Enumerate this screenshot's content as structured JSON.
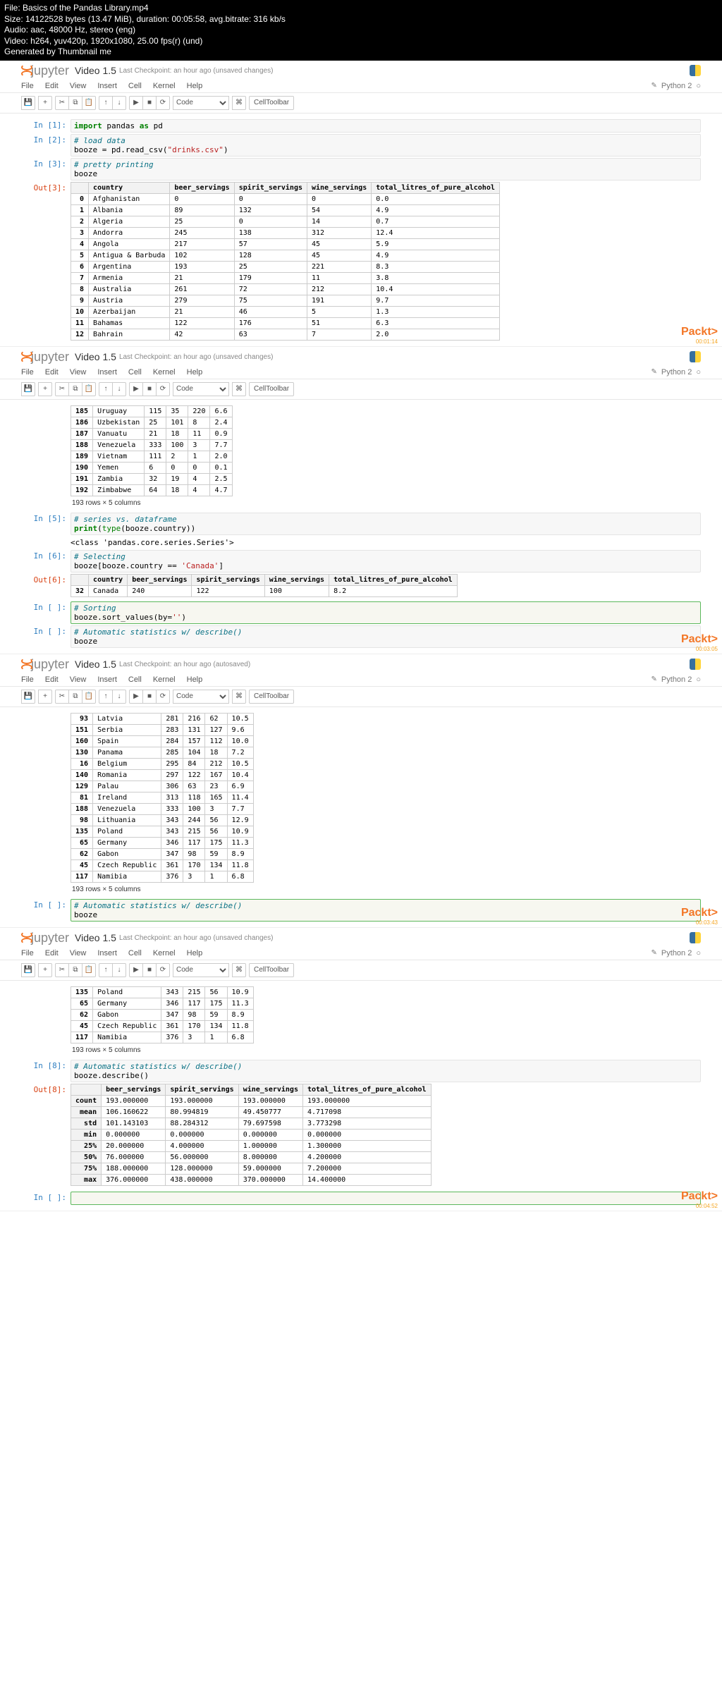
{
  "terminal": {
    "file": "File: Basics of the Pandas Library.mp4",
    "size": "Size: 14122528 bytes (13.47 MiB), duration: 00:05:58, avg.bitrate: 316 kb/s",
    "audio": "Audio: aac, 48000 Hz, stereo (eng)",
    "video": "Video: h264, yuv420p, 1920x1080, 25.00 fps(r) (und)",
    "gen": "Generated by Thumbnail me"
  },
  "brand": "jupyter",
  "title": "Video 1.5",
  "menus": [
    "File",
    "Edit",
    "View",
    "Insert",
    "Cell",
    "Kernel",
    "Help"
  ],
  "kernel": "Python 2",
  "toolbar": {
    "code": "Code",
    "celltb": "CellToolbar"
  },
  "packt": "Packt",
  "rowscols": "193 rows × 5 columns",
  "shots": {
    "s1": {
      "checkpoint": "Last Checkpoint: an hour ago (unsaved changes)",
      "ts": "00:01:14",
      "cols": [
        "country",
        "beer_servings",
        "spirit_servings",
        "wine_servings",
        "total_litres_of_pure_alcohol"
      ],
      "rows": [
        [
          "0",
          "Afghanistan",
          "0",
          "0",
          "0",
          "0.0"
        ],
        [
          "1",
          "Albania",
          "89",
          "132",
          "54",
          "4.9"
        ],
        [
          "2",
          "Algeria",
          "25",
          "0",
          "14",
          "0.7"
        ],
        [
          "3",
          "Andorra",
          "245",
          "138",
          "312",
          "12.4"
        ],
        [
          "4",
          "Angola",
          "217",
          "57",
          "45",
          "5.9"
        ],
        [
          "5",
          "Antigua & Barbuda",
          "102",
          "128",
          "45",
          "4.9"
        ],
        [
          "6",
          "Argentina",
          "193",
          "25",
          "221",
          "8.3"
        ],
        [
          "7",
          "Armenia",
          "21",
          "179",
          "11",
          "3.8"
        ],
        [
          "8",
          "Australia",
          "261",
          "72",
          "212",
          "10.4"
        ],
        [
          "9",
          "Austria",
          "279",
          "75",
          "191",
          "9.7"
        ],
        [
          "10",
          "Azerbaijan",
          "21",
          "46",
          "5",
          "1.3"
        ],
        [
          "11",
          "Bahamas",
          "122",
          "176",
          "51",
          "6.3"
        ],
        [
          "12",
          "Bahrain",
          "42",
          "63",
          "7",
          "2.0"
        ]
      ]
    },
    "s2": {
      "checkpoint": "Last Checkpoint: an hour ago (unsaved changes)",
      "ts": "00:03:05",
      "rows": [
        [
          "185",
          "Uruguay",
          "115",
          "35",
          "220",
          "6.6"
        ],
        [
          "186",
          "Uzbekistan",
          "25",
          "101",
          "8",
          "2.4"
        ],
        [
          "187",
          "Vanuatu",
          "21",
          "18",
          "11",
          "0.9"
        ],
        [
          "188",
          "Venezuela",
          "333",
          "100",
          "3",
          "7.7"
        ],
        [
          "189",
          "Vietnam",
          "111",
          "2",
          "1",
          "2.0"
        ],
        [
          "190",
          "Yemen",
          "6",
          "0",
          "0",
          "0.1"
        ],
        [
          "191",
          "Zambia",
          "32",
          "19",
          "4",
          "2.5"
        ],
        [
          "192",
          "Zimbabwe",
          "64",
          "18",
          "4",
          "4.7"
        ]
      ],
      "classout": "<class 'pandas.core.series.Series'>",
      "selcols": [
        "country",
        "beer_servings",
        "spirit_servings",
        "wine_servings",
        "total_litres_of_pure_alcohol"
      ],
      "selrow": [
        "32",
        "Canada",
        "240",
        "122",
        "100",
        "8.2"
      ]
    },
    "s3": {
      "checkpoint": "Last Checkpoint: an hour ago (autosaved)",
      "ts": "00:03:43",
      "rows": [
        [
          "93",
          "Latvia",
          "281",
          "216",
          "62",
          "10.5"
        ],
        [
          "151",
          "Serbia",
          "283",
          "131",
          "127",
          "9.6"
        ],
        [
          "160",
          "Spain",
          "284",
          "157",
          "112",
          "10.0"
        ],
        [
          "130",
          "Panama",
          "285",
          "104",
          "18",
          "7.2"
        ],
        [
          "16",
          "Belgium",
          "295",
          "84",
          "212",
          "10.5"
        ],
        [
          "140",
          "Romania",
          "297",
          "122",
          "167",
          "10.4"
        ],
        [
          "129",
          "Palau",
          "306",
          "63",
          "23",
          "6.9"
        ],
        [
          "81",
          "Ireland",
          "313",
          "118",
          "165",
          "11.4"
        ],
        [
          "188",
          "Venezuela",
          "333",
          "100",
          "3",
          "7.7"
        ],
        [
          "98",
          "Lithuania",
          "343",
          "244",
          "56",
          "12.9"
        ],
        [
          "135",
          "Poland",
          "343",
          "215",
          "56",
          "10.9"
        ],
        [
          "65",
          "Germany",
          "346",
          "117",
          "175",
          "11.3"
        ],
        [
          "62",
          "Gabon",
          "347",
          "98",
          "59",
          "8.9"
        ],
        [
          "45",
          "Czech Republic",
          "361",
          "170",
          "134",
          "11.8"
        ],
        [
          "117",
          "Namibia",
          "376",
          "3",
          "1",
          "6.8"
        ]
      ]
    },
    "s4": {
      "checkpoint": "Last Checkpoint: an hour ago (unsaved changes)",
      "ts": "00:04:52",
      "rows": [
        [
          "135",
          "Poland",
          "343",
          "215",
          "56",
          "10.9"
        ],
        [
          "65",
          "Germany",
          "346",
          "117",
          "175",
          "11.3"
        ],
        [
          "62",
          "Gabon",
          "347",
          "98",
          "59",
          "8.9"
        ],
        [
          "45",
          "Czech Republic",
          "361",
          "170",
          "134",
          "11.8"
        ],
        [
          "117",
          "Namibia",
          "376",
          "3",
          "1",
          "6.8"
        ]
      ],
      "desccols": [
        "beer_servings",
        "spirit_servings",
        "wine_servings",
        "total_litres_of_pure_alcohol"
      ],
      "desc": [
        [
          "count",
          "193.000000",
          "193.000000",
          "193.000000",
          "193.000000"
        ],
        [
          "mean",
          "106.160622",
          "80.994819",
          "49.450777",
          "4.717098"
        ],
        [
          "std",
          "101.143103",
          "88.284312",
          "79.697598",
          "3.773298"
        ],
        [
          "min",
          "0.000000",
          "0.000000",
          "0.000000",
          "0.000000"
        ],
        [
          "25%",
          "20.000000",
          "4.000000",
          "1.000000",
          "1.300000"
        ],
        [
          "50%",
          "76.000000",
          "56.000000",
          "8.000000",
          "4.200000"
        ],
        [
          "75%",
          "188.000000",
          "128.000000",
          "59.000000",
          "7.200000"
        ],
        [
          "max",
          "376.000000",
          "438.000000",
          "370.000000",
          "14.400000"
        ]
      ]
    }
  },
  "code": {
    "c1": "import pandas as pd",
    "c2a": "# load data",
    "c2b": "booze = pd.read_csv(\"drinks.csv\")",
    "c3a": "# pretty printing",
    "c3b": "booze",
    "c5a": "# series vs. dataframe",
    "c5b": "print(type(booze.country))",
    "c6a": "# Selecting",
    "c6b": "booze[booze.country == 'Canada']",
    "c7a": "# Sorting",
    "c7b": "booze.sort_values(by='')",
    "c8a": "# Automatic statistics w/ describe()",
    "c8b": "booze",
    "c9a": "# Automatic statistics w/ describe()",
    "c9b": "booze.describe()"
  }
}
